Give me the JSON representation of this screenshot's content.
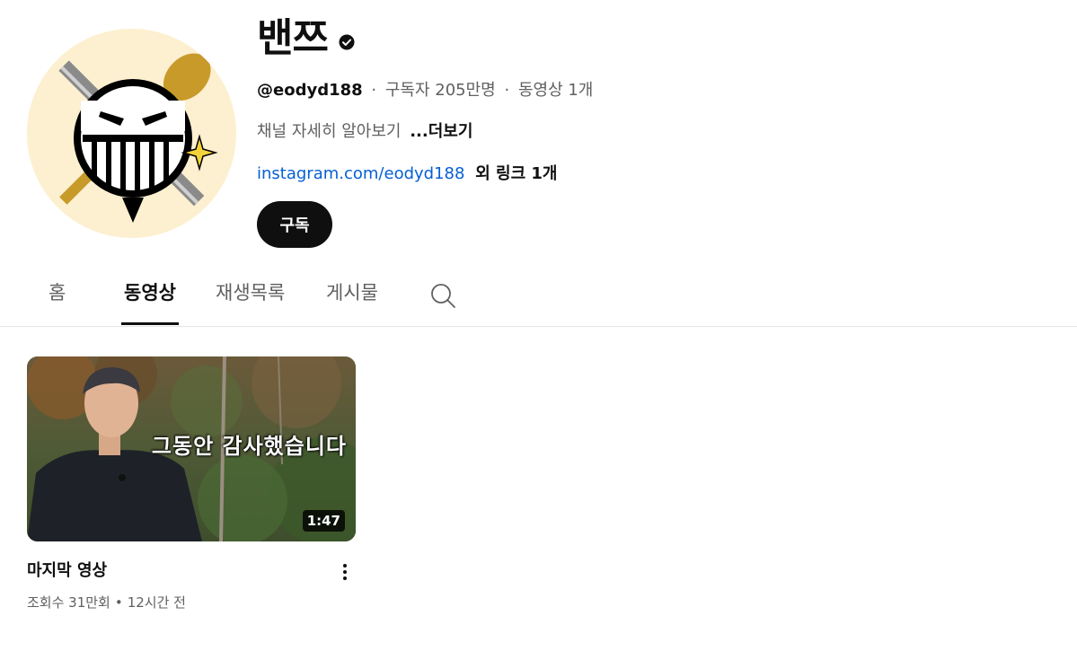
{
  "channel": {
    "name": "밴쯔",
    "verified_icon": "verified-check-icon",
    "handle": "@eodyd188",
    "subscribers": "구독자 205만명",
    "video_count": "동영상 1개",
    "separator": "·",
    "description": "채널 자세히 알아보기",
    "more_label": "...더보기",
    "link": "instagram.com/eodyd188",
    "extra_links": "외 링크 1개",
    "subscribe_label": "구독",
    "avatar_icon": "channel-logo-skull-icon"
  },
  "tabs": [
    {
      "label": "홈",
      "active": false
    },
    {
      "label": "동영상",
      "active": true
    },
    {
      "label": "재생목록",
      "active": false
    },
    {
      "label": "게시물",
      "active": false
    }
  ],
  "search_icon": "search-icon",
  "videos": [
    {
      "title": "마지막 영상",
      "thumbnail_text": "그동안 감사했습니다",
      "duration": "1:47",
      "views": "조회수 31만회",
      "separator": "•",
      "age": "12시간 전",
      "menu_icon": "more-vert-icon"
    }
  ],
  "colors": {
    "link": "#065fd4",
    "text_primary": "#0f0f0f",
    "text_secondary": "#606060",
    "avatar_bg": "#fdf0d0",
    "button_bg": "#0f0f0f"
  }
}
